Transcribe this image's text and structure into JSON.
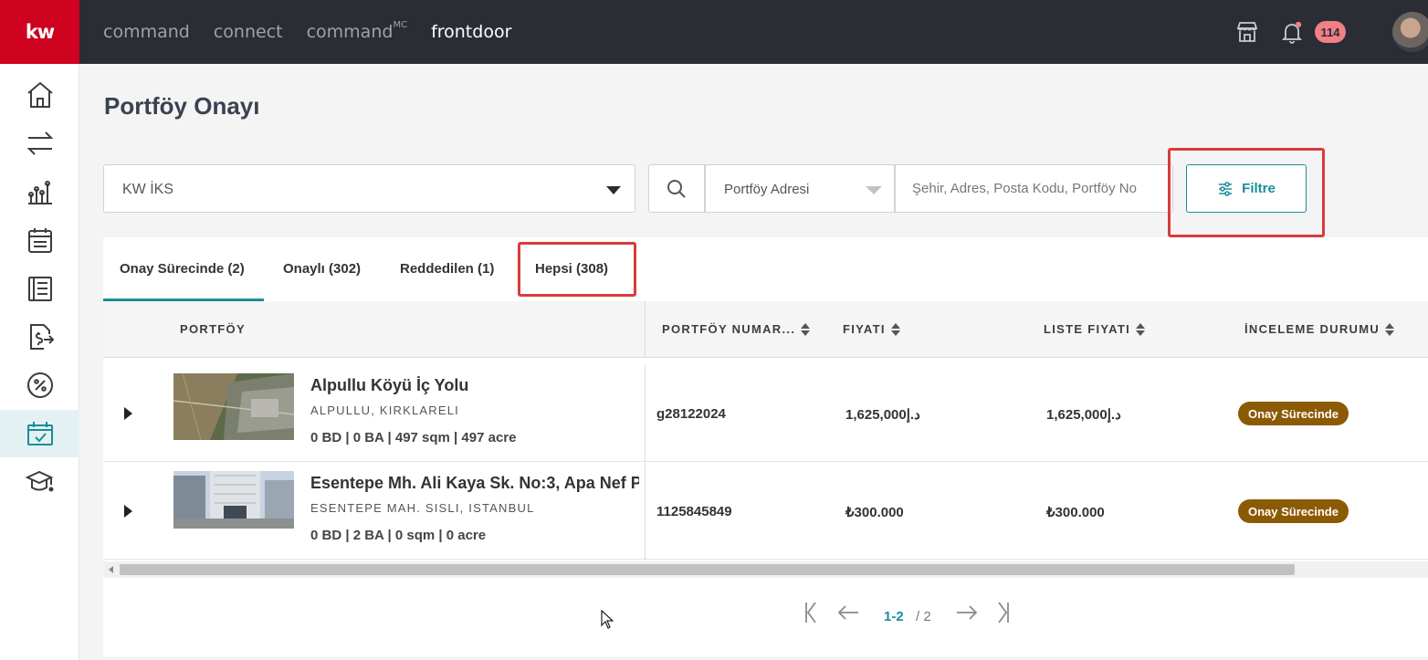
{
  "topbar": {
    "logo": "kw",
    "nav": [
      {
        "label": "command",
        "active": false
      },
      {
        "label": "connect",
        "active": false
      },
      {
        "label": "command",
        "sup": "MC",
        "active": false
      },
      {
        "label": "frontdoor",
        "active": true
      }
    ],
    "notification_count": "114",
    "icons": [
      "store-icon",
      "bell-icon",
      "user-avatar"
    ]
  },
  "sidebar": {
    "items": [
      "home-icon",
      "transfer-icon",
      "analytics-icon",
      "calendar-icon",
      "document-icon",
      "money-icon",
      "percent-icon",
      "approval-icon",
      "education-icon"
    ],
    "active_index": 7
  },
  "page": {
    "title": "Portföy Onayı"
  },
  "search": {
    "office_value": "KW İKS",
    "type_value": "Portföy Adresi",
    "placeholder": "Şehir, Adres, Posta Kodu, Portföy No",
    "filter_label": "Filtre"
  },
  "tabs": [
    {
      "label": "Onay Sürecinde (2)",
      "active": true
    },
    {
      "label": "Onaylı (302)",
      "active": false
    },
    {
      "label": "Reddedilen (1)",
      "active": false
    },
    {
      "label": "Hepsi (308)",
      "active": false
    }
  ],
  "table": {
    "columns": [
      "PORTFÖY",
      "PORTFÖY NUMAR...",
      "FIYATI",
      "LISTE FIYATI",
      "İNCELEME DURUMU"
    ],
    "rows": [
      {
        "title": "Alpullu Köyü İç Yolu",
        "city": "ALPULLU, KIRKLARELI",
        "specs": "0 BD | 0 BA | 497 sqm | 497 acre",
        "number": "g28122024",
        "price": "1,625,000د.إ",
        "list_price": "1,625,000د.إ",
        "status": "Onay Sürecinde"
      },
      {
        "title": "Esentepe Mh. Ali Kaya Sk. No:3, Apa Nef P",
        "city": "ESENTEPE MAH. SISLI, ISTANBUL",
        "specs": "0 BD | 2 BA | 0 sqm | 0 acre",
        "number": "1125845849",
        "price": "₺300.000",
        "list_price": "₺300.000",
        "status": "Onay Sürecinde"
      }
    ]
  },
  "pagination": {
    "range": "1-2",
    "total": "/ 2"
  },
  "colors": {
    "accent": "#1b8d9b",
    "brand": "#ce011f",
    "status_pending": "#8b5a05",
    "highlight": "#d93b3b"
  }
}
